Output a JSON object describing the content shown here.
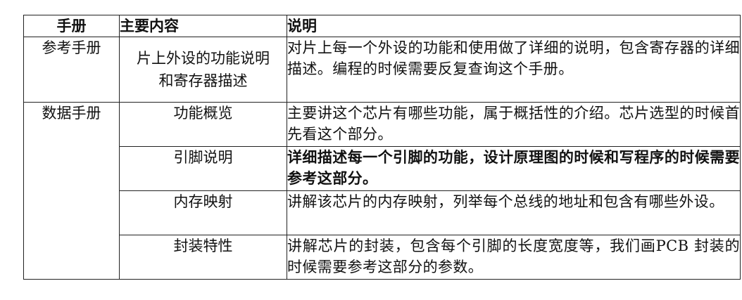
{
  "headers": {
    "manual": "手册",
    "content": "主要内容",
    "desc": "说明"
  },
  "rows": [
    {
      "manual": "参考手册",
      "content": "片上外设的功能说明和寄存器描述",
      "desc": "对片上每一个外设的功能和使用做了详细的说明，包含寄存器的详细描述。编程的时候需要反复查询这个手册。",
      "bold": false
    },
    {
      "manual": "数据手册",
      "content": "功能概览",
      "desc": "主要讲这个芯片有哪些功能，属于概括性的介绍。芯片选型的时候首先看这个部分。",
      "bold": false
    },
    {
      "content": "引脚说明",
      "desc": "详细描述每一个引脚的功能，设计原理图的时候和写程序的时候需要参考这部分。",
      "bold": true
    },
    {
      "content": "内存映射",
      "desc": "讲解该芯片的内存映射，列举每个总线的地址和包含有哪些外设。",
      "bold": false
    },
    {
      "content": "封装特性",
      "desc": "讲解芯片的封装，包含每个引脚的长度宽度等，我们画PCB 封装的时候需要参考这部分的参数。",
      "bold": false
    }
  ]
}
